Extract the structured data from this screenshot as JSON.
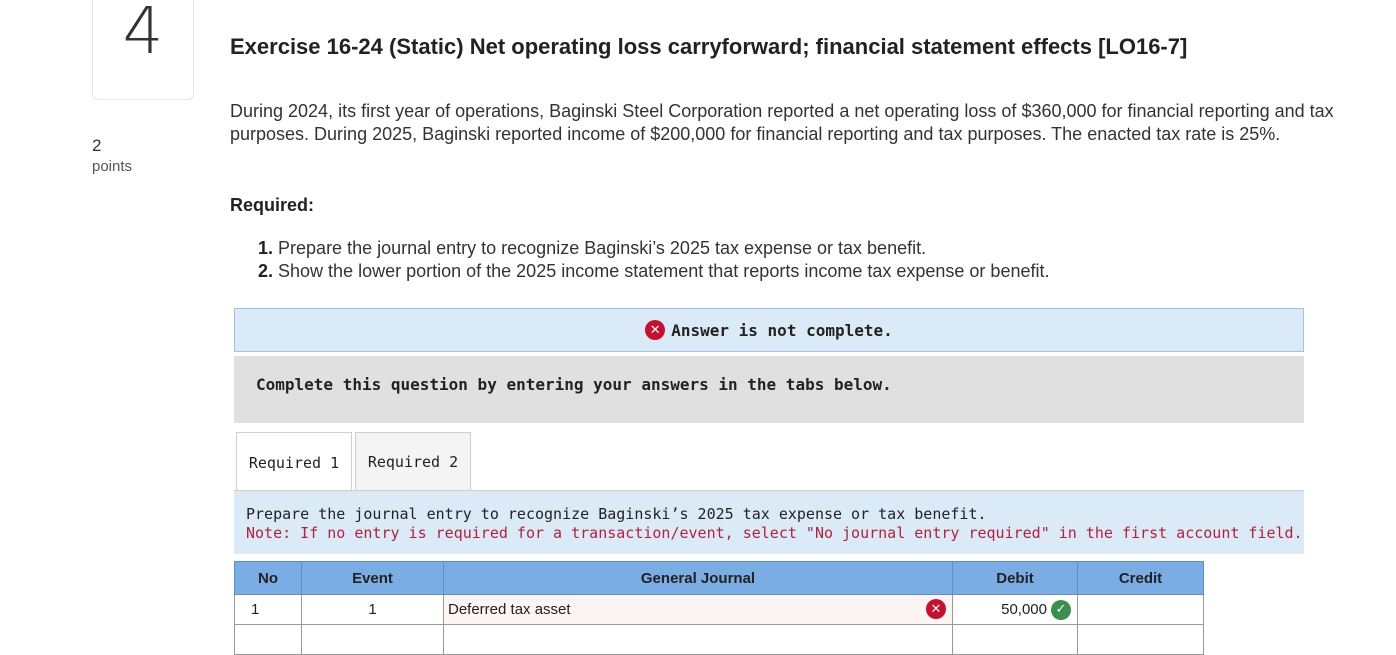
{
  "question": {
    "number": "4",
    "points_value": "2",
    "points_label": "points"
  },
  "title": "Exercise 16-24 (Static) Net operating loss carryforward; financial statement effects [LO16-7]",
  "intro": "During 2024, its first year of operations, Baginski Steel Corporation reported a net operating loss of $360,000 for financial reporting and tax purposes. During 2025, Baginski reported income of $200,000 for financial reporting and tax purposes. The enacted tax rate is 25%.",
  "required_label": "Required:",
  "requirements": [
    {
      "num": "1.",
      "text": "Prepare the journal entry to recognize Baginski’s 2025 tax expense or tax benefit."
    },
    {
      "num": "2.",
      "text": "Show the lower portion of the 2025 income statement that reports income tax expense or benefit."
    }
  ],
  "banner": {
    "text": "Answer is not complete.",
    "icon": "x-circle-icon",
    "color": "#c8102e"
  },
  "instruction_panel": "Complete this question by entering your answers in the tabs below.",
  "tabs": [
    {
      "label": "Required 1",
      "active": true
    },
    {
      "label": "Required 2",
      "active": false
    }
  ],
  "tab_instructions": {
    "main": "Prepare the journal entry to recognize Baginski’s 2025 tax expense or tax benefit.",
    "note": "Note: If no entry is required for a transaction/event, select \"No journal entry required\" in the first account field."
  },
  "journal": {
    "headers": [
      "No",
      "Event",
      "General Journal",
      "Debit",
      "Credit"
    ],
    "rows": [
      {
        "no": "1",
        "event": "1",
        "account": "Deferred tax asset",
        "account_status": "incorrect",
        "debit": "50,000",
        "debit_status": "correct",
        "credit": ""
      },
      {
        "no": "",
        "event": "",
        "account": "",
        "debit": "",
        "credit": ""
      }
    ]
  }
}
